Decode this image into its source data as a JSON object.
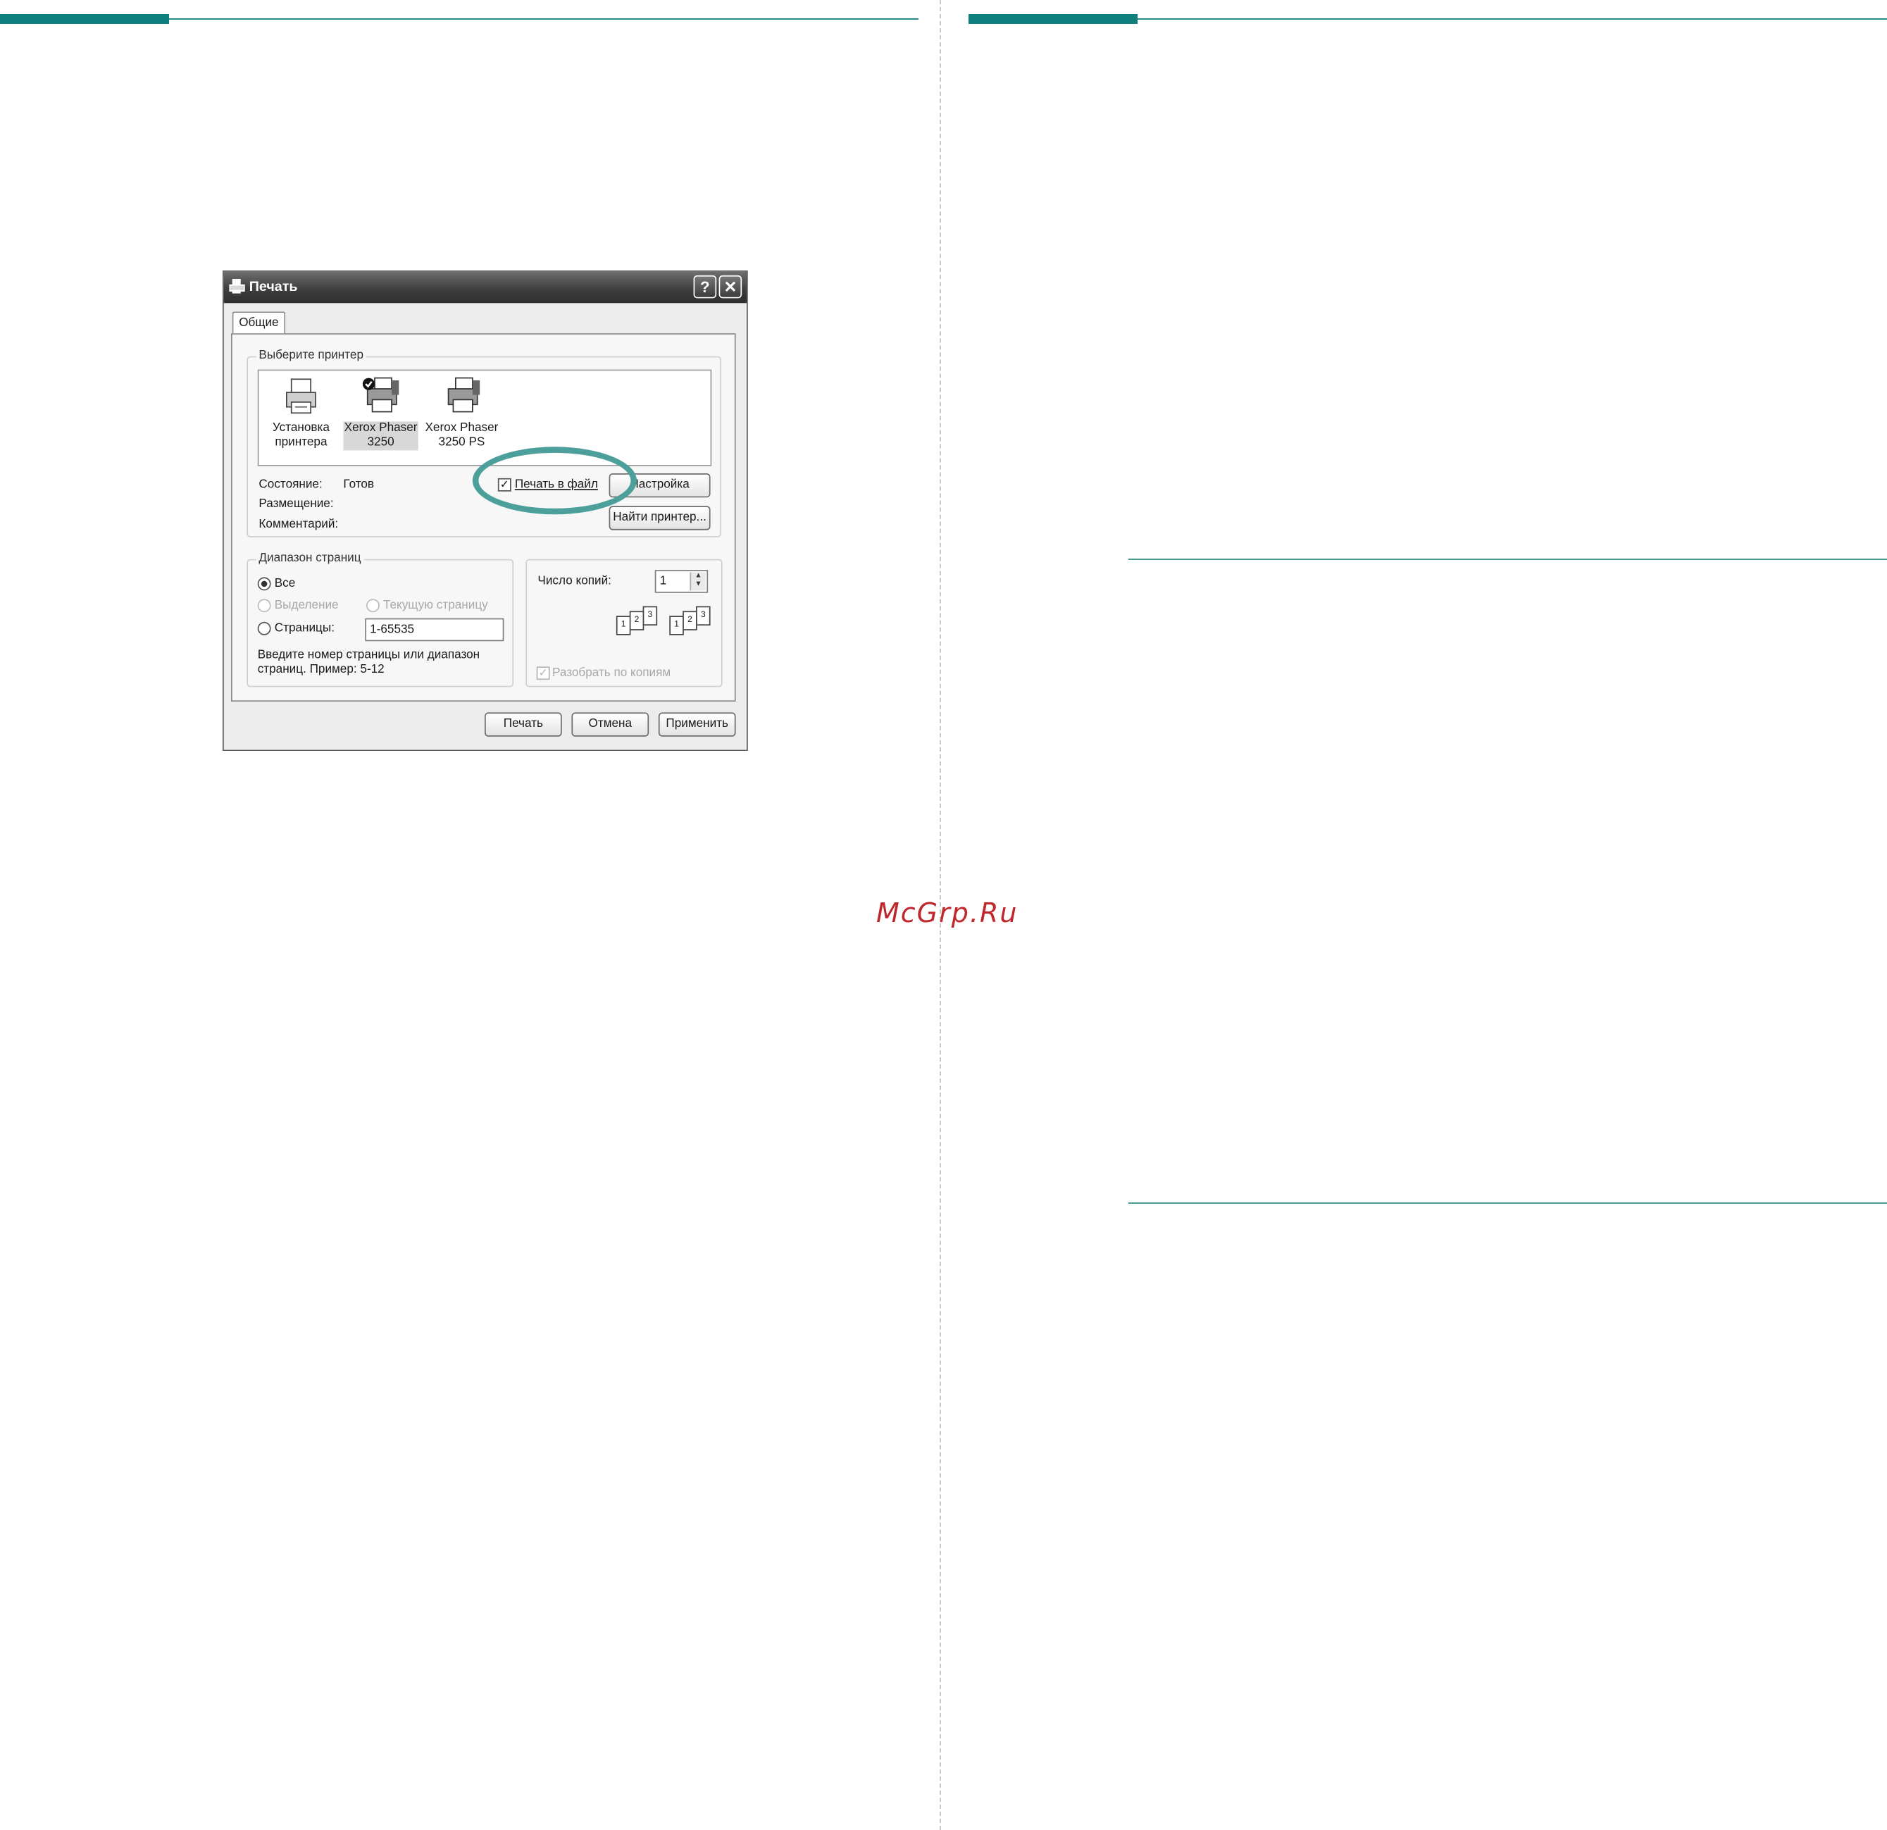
{
  "watermark": "McGrp.Ru",
  "dialog": {
    "title": "Печать",
    "help_button": "?",
    "close_button": "✕",
    "tab_general": "Общие",
    "select_printer": {
      "legend": "Выберите принтер",
      "items": [
        {
          "line1": "Установка",
          "line2": "принтера"
        },
        {
          "line1": "Xerox Phaser",
          "line2": "3250"
        },
        {
          "line1": "Xerox Phaser",
          "line2": "3250 PS"
        }
      ]
    },
    "status_label": "Состояние:",
    "status_value": "Готов",
    "location_label": "Размещение:",
    "comment_label": "Комментарий:",
    "print_to_file": "Печать в файл",
    "print_to_file_checked": true,
    "setup_button": "Настройка",
    "find_printer_button": "Найти принтер...",
    "page_range": {
      "legend": "Диапазон страниц",
      "all": "Все",
      "selection": "Выделение",
      "current_page": "Текущую страницу",
      "pages": "Страницы:",
      "pages_value": "1-65535",
      "hint_line1": "Введите номер страницы или диапазон",
      "hint_line2": "страниц.  Пример: 5-12"
    },
    "copies": {
      "label": "Число копий:",
      "value": "1",
      "collate": "Разобрать по копиям",
      "collate_checked": true
    },
    "print_button": "Печать",
    "cancel_button": "Отмена",
    "apply_button": "Применить"
  },
  "colors": {
    "accent": "#0e7f7c",
    "highlight": "#4d9f9c",
    "watermark": "#c0272d"
  }
}
